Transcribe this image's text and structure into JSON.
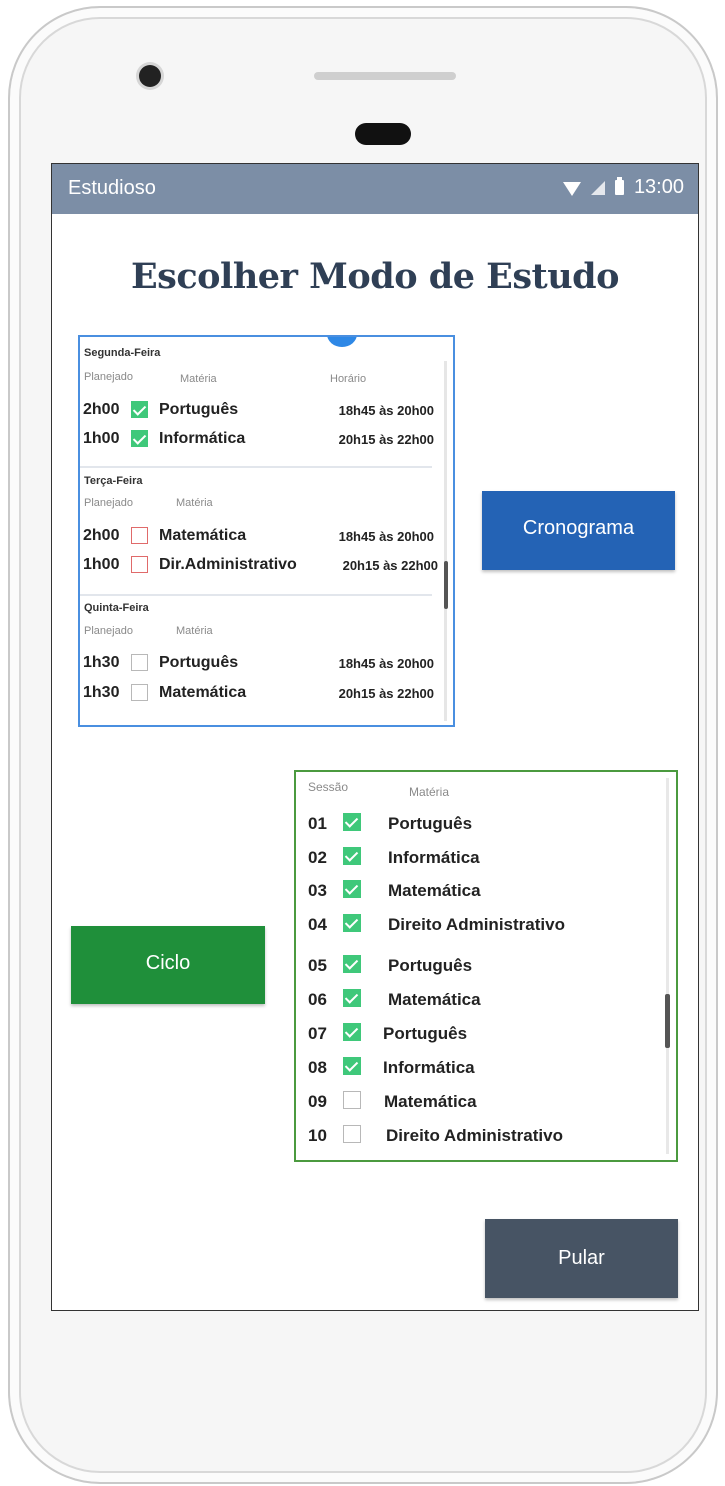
{
  "app": {
    "title": "Estudioso",
    "time": "13:00"
  },
  "page": {
    "title": "Escolher Modo de Estudo"
  },
  "schedule": {
    "days": [
      {
        "name": "Segunda-Feira",
        "headers": {
          "planned": "Planejado",
          "subject": "Matéria",
          "time": "Horário"
        },
        "rows": [
          {
            "planned": "2h00",
            "status": "checked",
            "subject": "Português",
            "time": "18h45 às 20h00"
          },
          {
            "planned": "1h00",
            "status": "checked",
            "subject": "Informática",
            "time": "20h15 às 22h00"
          }
        ]
      },
      {
        "name": "Terça-Feira",
        "headers": {
          "planned": "Planejado",
          "subject": "Matéria",
          "time": ""
        },
        "rows": [
          {
            "planned": "2h00",
            "status": "missed",
            "subject": "Matemática",
            "time": "18h45 às 20h00"
          },
          {
            "planned": "1h00",
            "status": "missed",
            "subject": "Dir.Administrativo",
            "time": "20h15 às 22h00"
          }
        ]
      },
      {
        "name": "Quinta-Feira",
        "headers": {
          "planned": "Planejado",
          "subject": "Matéria",
          "time": ""
        },
        "rows": [
          {
            "planned": "1h30",
            "status": "empty",
            "subject": "Português",
            "time": "18h45 às 20h00"
          },
          {
            "planned": "1h30",
            "status": "empty",
            "subject": "Matemática",
            "time": "20h15 às 22h00"
          }
        ]
      }
    ]
  },
  "buttons": {
    "cronograma": "Cronograma",
    "ciclo": "Ciclo",
    "pular": "Pular"
  },
  "cycle": {
    "headers": {
      "session": "Sessão",
      "subject": "Matéria"
    },
    "rows": [
      {
        "num": "01",
        "checked": true,
        "subject": "Português"
      },
      {
        "num": "02",
        "checked": true,
        "subject": "Informática"
      },
      {
        "num": "03",
        "checked": true,
        "subject": "Matemática"
      },
      {
        "num": "04",
        "checked": true,
        "subject": "Direito Administrativo"
      },
      {
        "num": "05",
        "checked": true,
        "subject": "Português"
      },
      {
        "num": "06",
        "checked": true,
        "subject": "Matemática"
      },
      {
        "num": "07",
        "checked": true,
        "subject": "Português"
      },
      {
        "num": "08",
        "checked": true,
        "subject": "Informática"
      },
      {
        "num": "09",
        "checked": false,
        "subject": "Matemática"
      },
      {
        "num": "10",
        "checked": false,
        "subject": "Direito Administrativo"
      }
    ]
  },
  "colors": {
    "statusbar": "#7c8ea6",
    "cronograma": "#2463b5",
    "ciclo": "#1f8f3a",
    "pular": "#475464",
    "check": "#3fc87a",
    "missed": "#e06a6a"
  }
}
